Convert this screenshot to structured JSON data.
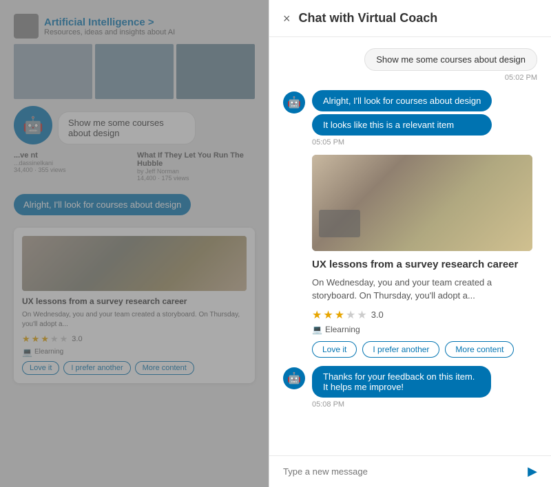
{
  "app": {
    "title": "Chat with Virtual Coach",
    "close_label": "×"
  },
  "left_panel": {
    "section_title": "Artificial Intelligence >",
    "section_subtitle": "Resources, ideas and insights about AI",
    "speech_bubble": "Show me some courses about design",
    "bot_reply1": "Alright, I'll look for courses about design",
    "course": {
      "title": "UX lessons from a survey research career",
      "description": "On Wednesday, you and your team created a storyboard. On Thursday, you'll adopt a...",
      "rating": "3.0",
      "type": "Elearning",
      "btn1": "Love it",
      "btn2": "I prefer another",
      "btn3": "More content"
    }
  },
  "chat": {
    "header_title": "Chat with Virtual Coach",
    "close_btn": "×",
    "messages": [
      {
        "type": "user",
        "text": "Show me some courses about design",
        "time": "05:02 PM"
      },
      {
        "type": "bot",
        "bubbles": [
          "Alright, I'll look for courses about design",
          "It looks like this is a relevant item"
        ],
        "time": "05:05 PM"
      }
    ],
    "course_card": {
      "title": "UX lessons from a survey research career",
      "description": "On Wednesday, you and your team created a storyboard. On Thursday, you'll adopt a...",
      "rating": "3.0",
      "type": "Elearning",
      "btn1": "Love it",
      "btn2": "I prefer another",
      "btn3": "More content"
    },
    "bot_message2": {
      "text": "Thanks for your feedback on this item. It helps me improve!",
      "time": "05:08 PM"
    },
    "input_placeholder": "Type a new message"
  },
  "icons": {
    "robot": "🤖",
    "send": "▶",
    "laptop": "💻",
    "star_filled": "★",
    "star_empty": "☆"
  }
}
